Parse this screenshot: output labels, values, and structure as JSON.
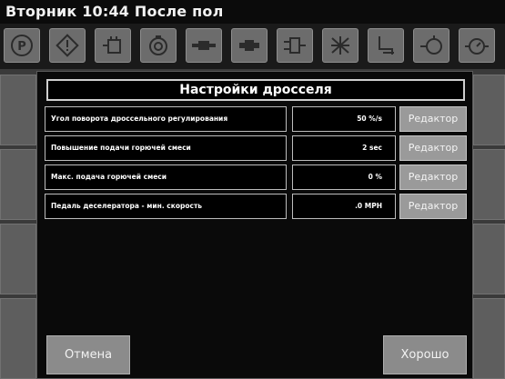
{
  "header": {
    "title": "Вторник 10:44 После пол"
  },
  "iconbar": {
    "icons": [
      "parking-brake-icon",
      "warning-icon",
      "hydraulic-tank-icon",
      "engine-icon",
      "transmission-icon",
      "driveshaft-icon",
      "filter-icon",
      "cooling-fan-icon",
      "exhaust-icon",
      "hydraulic-pump-icon",
      "gauge-icon"
    ]
  },
  "dialog": {
    "title": "Настройки дросселя",
    "rows": [
      {
        "label": "Угол поворота дроссельного регулирования",
        "value": "50 %/s",
        "edit": "Редактор"
      },
      {
        "label": "Повышение подачи горючей смеси",
        "value": "2 sec",
        "edit": "Редактор"
      },
      {
        "label": "Макс. подача горючей смеси",
        "value": "0 %",
        "edit": "Редактор"
      },
      {
        "label": "Педаль деселератора - мин. скорость",
        "value": ".0 MPH",
        "edit": "Редактор"
      }
    ],
    "cancel_label": "Отмена",
    "ok_label": "Хорошо"
  },
  "colors": {
    "background": "#3a3a3a",
    "header": "#0b0b0b",
    "dialog": "#0a0a0a",
    "button": "#9a9a9a"
  }
}
